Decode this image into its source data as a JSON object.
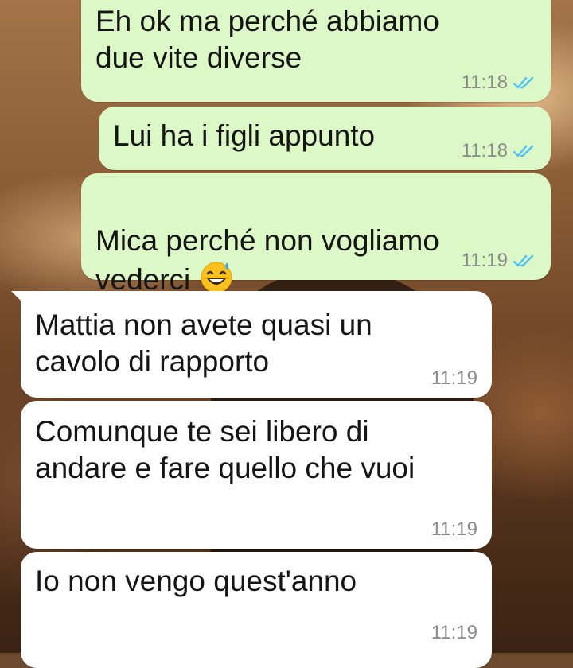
{
  "chat": {
    "messages": [
      {
        "direction": "outgoing",
        "text": "Eh ok ma perché abbiamo\ndue vite diverse",
        "time": "11:18",
        "status_icon": "double-check-read-icon"
      },
      {
        "direction": "outgoing",
        "text": "Lui ha i figli appunto",
        "time": "11:18",
        "status_icon": "double-check-read-icon"
      },
      {
        "direction": "outgoing",
        "text_before_emoji": "Mica perché non vogliamo\nvederci ",
        "emoji": "grinning-face-with-sweat-icon",
        "time": "11:19",
        "status_icon": "double-check-read-icon"
      },
      {
        "direction": "incoming",
        "text": "Mattia non avete quasi un\ncavolo di rapporto",
        "time": "11:19"
      },
      {
        "direction": "incoming",
        "text": "Comunque te sei libero di\nandare e fare quello che vuoi",
        "time": "11:19"
      },
      {
        "direction": "incoming",
        "text": "Io non vengo quest'anno",
        "time": "11:19"
      }
    ]
  },
  "theme": {
    "outgoing_bubble": "#dcf8c6",
    "incoming_bubble": "#ffffff",
    "read_tick": "#4fc3f7",
    "time_color": "#8a8a8a"
  }
}
